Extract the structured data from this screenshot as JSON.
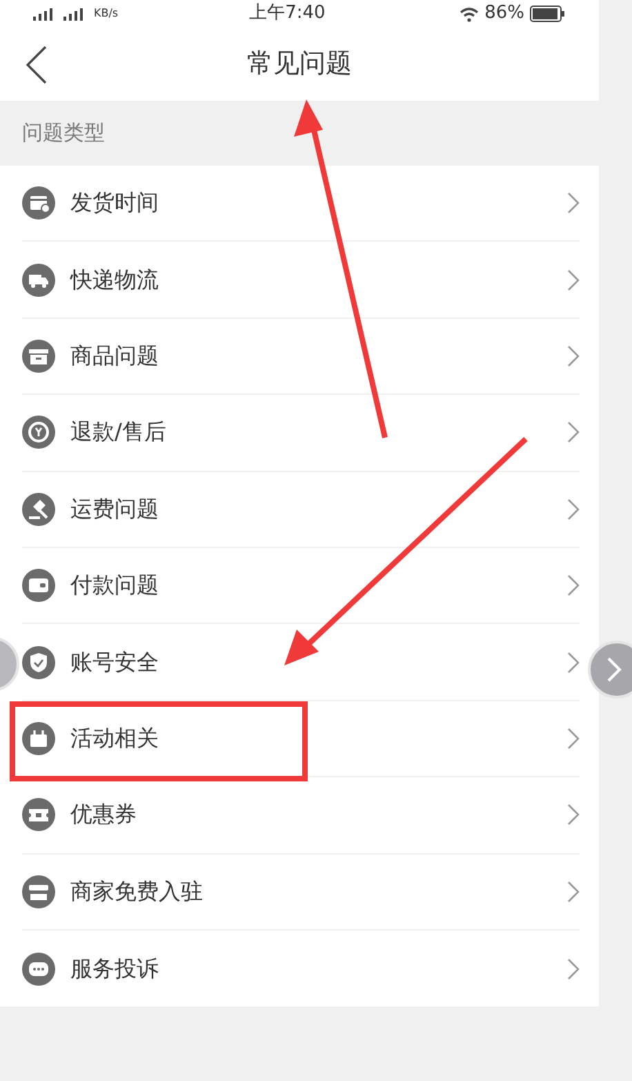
{
  "status_bar": {
    "speed_unit": "KB/s",
    "time": "上午7:40",
    "battery": "86%"
  },
  "nav_bar": {
    "title": "常见问题"
  },
  "section": {
    "title": "问题类型"
  },
  "items": [
    {
      "label": "发货时间",
      "boxed": false
    },
    {
      "label": "快递物流",
      "boxed": false
    },
    {
      "label": "商品问题",
      "boxed": false
    },
    {
      "label": "退款/售后",
      "boxed": false
    },
    {
      "label": "运费问题",
      "boxed": false
    },
    {
      "label": "付款问题",
      "boxed": false
    },
    {
      "label": "账号安全",
      "boxed": false
    },
    {
      "label": "活动相关",
      "boxed": true
    },
    {
      "label": "优惠券",
      "boxed": false
    },
    {
      "label": "商家免费入驻",
      "boxed": false
    },
    {
      "label": "服务投诉",
      "boxed": false
    }
  ]
}
